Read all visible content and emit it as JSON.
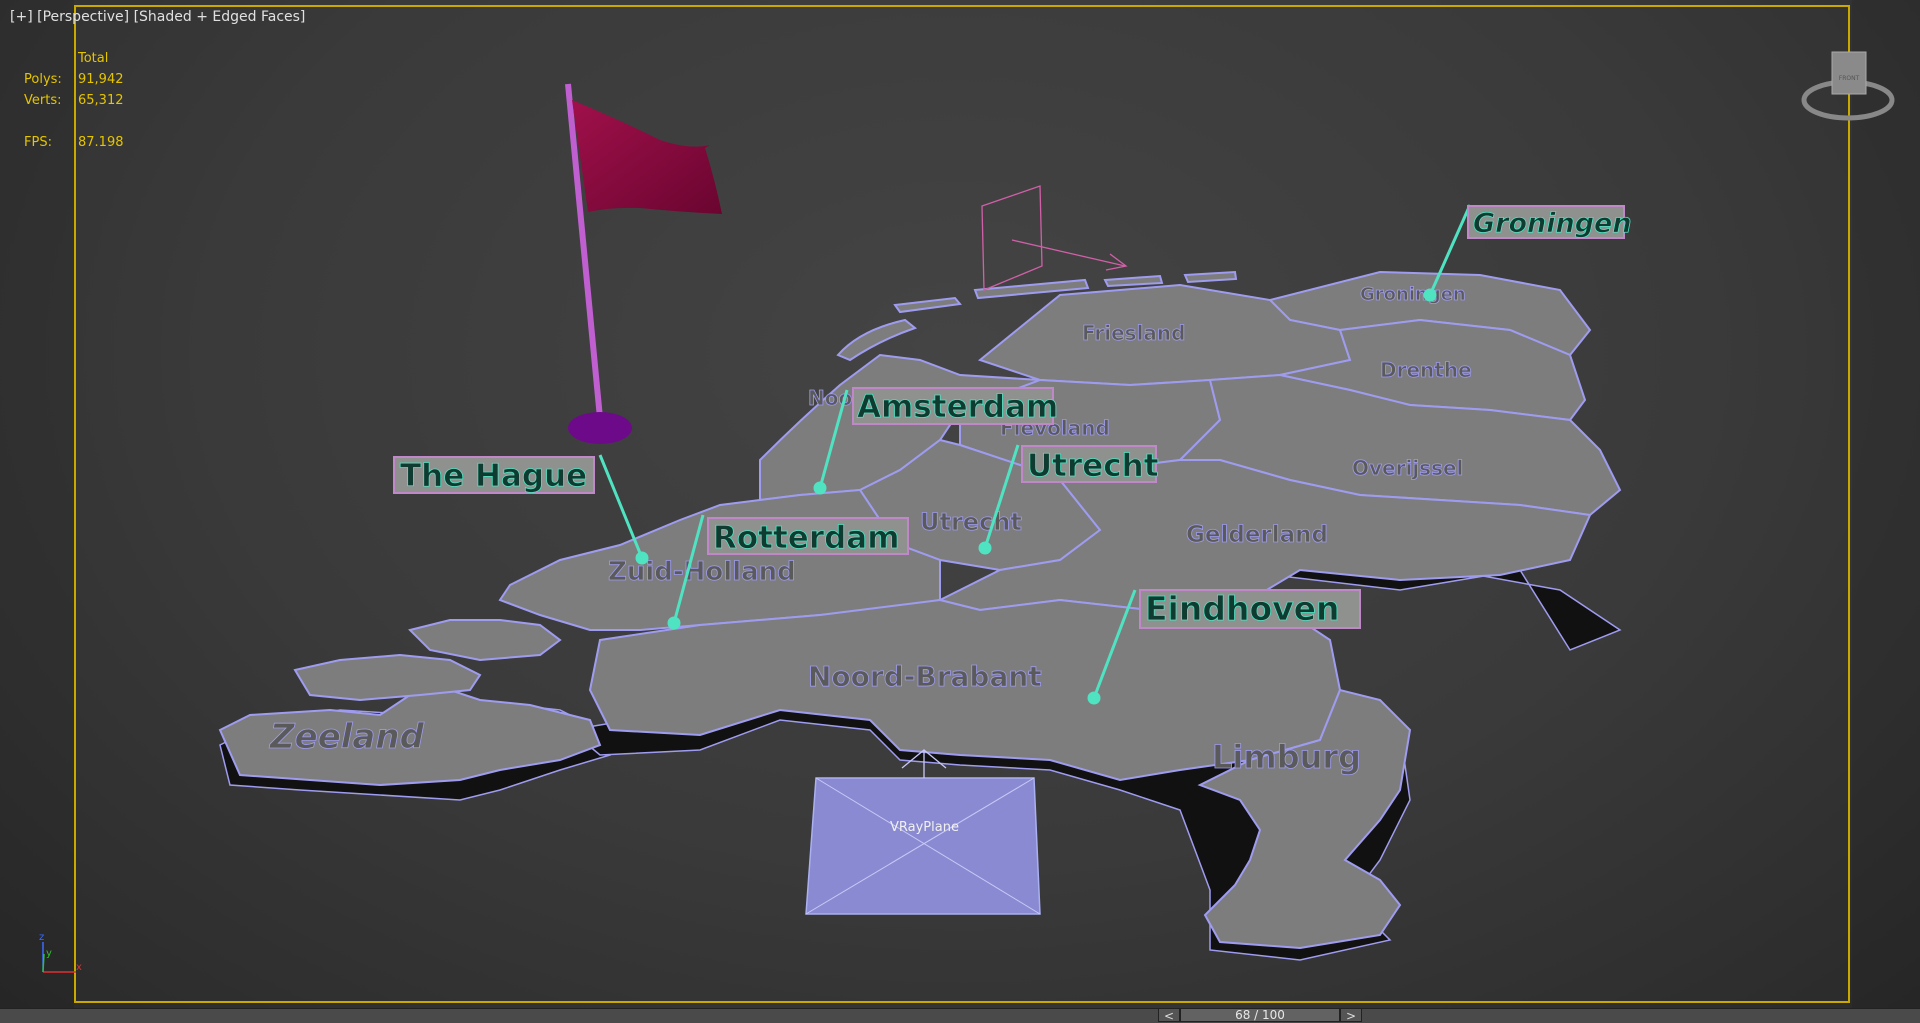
{
  "viewport": {
    "label_parts": [
      "[+]",
      "[Perspective]",
      "[Shaded + Edged Faces]"
    ],
    "stats": {
      "header": "Total",
      "polys_label": "Polys:",
      "polys_value": "91,942",
      "verts_label": "Verts:",
      "verts_value": "65,312",
      "fps_label": "FPS:",
      "fps_value": "87.198"
    },
    "viewcube_label": "FRONT",
    "axis": {
      "z": "z",
      "y": "y",
      "x": "x"
    }
  },
  "provinces": [
    "Friesland",
    "Groningen",
    "Drenthe",
    "Noord-Holland",
    "Flevoland",
    "Overijssel",
    "Utrecht",
    "Gelderland",
    "Zuid-Holland",
    "Noord-Brabant",
    "Zeeland",
    "Limburg"
  ],
  "cities": [
    "The Hague",
    "Amsterdam",
    "Utrecht",
    "Rotterdam",
    "Eindhoven",
    "Groningen"
  ],
  "objects": {
    "vray_plane": "VRayPlane"
  },
  "timeline": {
    "prev": "<",
    "frame": "68 / 100",
    "next": ">"
  },
  "colors": {
    "frame": "#c9a800",
    "stats": "#e5c400",
    "map_fill": "#7d7d7d",
    "map_edge": "#9f9cf0",
    "label_text": "#0f3b30",
    "label_bg": "#8f918f",
    "leader": "#4fe3c2",
    "flag": "#8a0a3a",
    "flag_pole": "#c060d0",
    "plane": "#8a8ad2"
  }
}
